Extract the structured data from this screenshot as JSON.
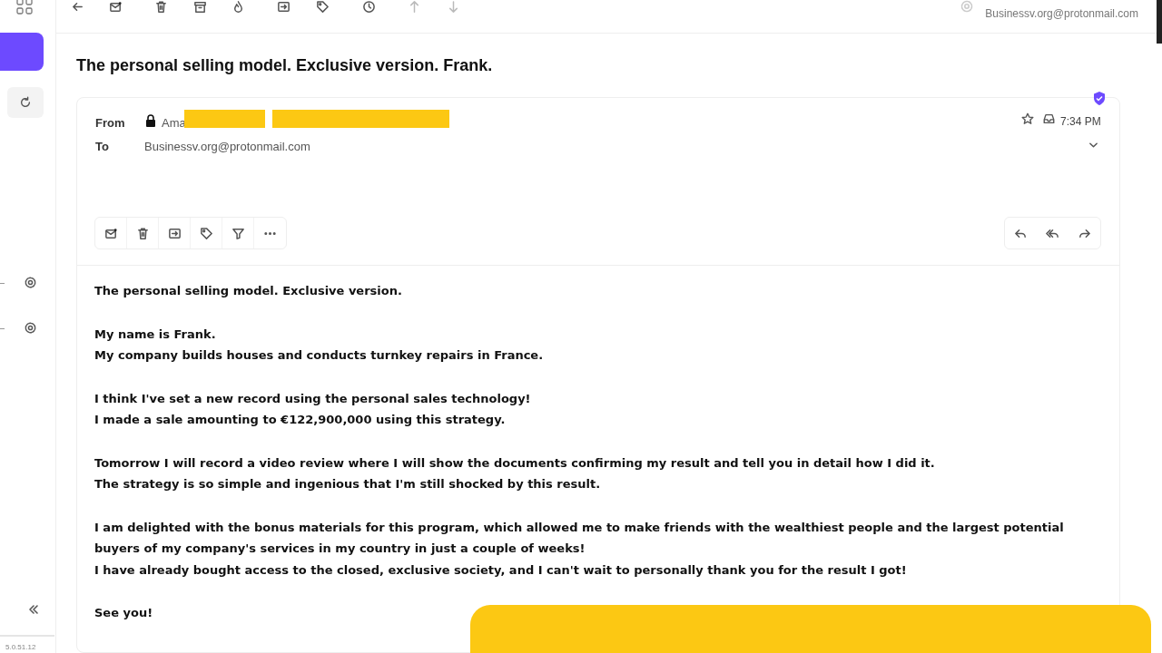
{
  "sidebar": {
    "version": "5.0.51.12"
  },
  "account": {
    "email": "Businessv.org@protonmail.com"
  },
  "message": {
    "subject": "The personal selling model. Exclusive version. Frank.",
    "from_label": "From",
    "sender_visible": "Ama",
    "to_label": "To",
    "recipient": "Businessv.org@protonmail.com",
    "time": "7:34 PM",
    "body": [
      [
        "The personal selling model. Exclusive version."
      ],
      [
        "My name is Frank.",
        "My company builds houses and conducts turnkey repairs in France."
      ],
      [
        "I think I've set a new record using the personal sales technology!",
        "I made a sale amounting to €122,900,000 using this strategy."
      ],
      [
        "Tomorrow I will record a video review where I will show the documents confirming my result and tell you in detail how I did it.",
        "The strategy is so simple and ingenious that I'm still shocked by this result."
      ],
      [
        "I am delighted with the bonus materials for this program, which allowed me to make friends with the wealthiest people and the largest potential buyers of my company's services in my country in just a couple of weeks!",
        "I have already bought access to the closed, exclusive society, and I can't wait to personally thank you for the result I got!"
      ],
      [
        "See you!"
      ]
    ]
  }
}
